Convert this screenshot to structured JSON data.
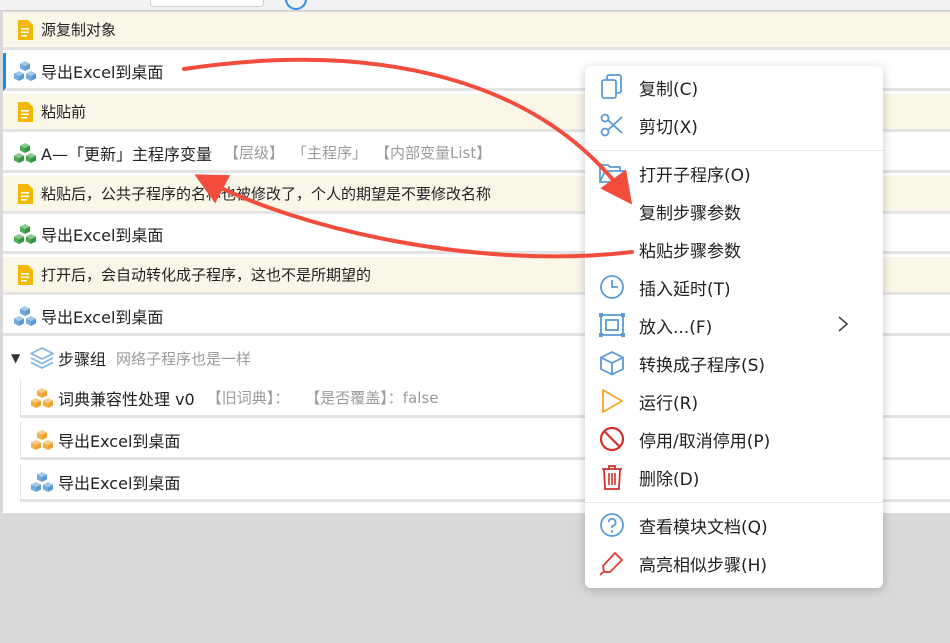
{
  "rows": {
    "r1": {
      "text": "源复制对象"
    },
    "r2": {
      "text": "导出Excel到桌面"
    },
    "r3": {
      "text": "粘贴前"
    },
    "r4": {
      "text": "A—「更新」主程序变量",
      "params": [
        "【层级】",
        "「主程序」",
        "【内部变量List】"
      ]
    },
    "r5": {
      "text": "粘贴后，公共子程序的名称也被修改了，个人的期望是不要修改名称"
    },
    "r6": {
      "text": "导出Excel到桌面"
    },
    "r7": {
      "text": "打开后，会自动转化成子程序，这也不是所期望的"
    },
    "r8": {
      "text": "导出Excel到桌面"
    },
    "group": {
      "text": "步骤组",
      "desc": "网络子程序也是一样"
    },
    "c1": {
      "text": "词典兼容性处理 v0",
      "params": [
        "【旧词典】：",
        "【是否覆盖】：false"
      ]
    },
    "c2": {
      "text": "导出Excel到桌面"
    },
    "c3": {
      "text": "导出Excel到桌面"
    }
  },
  "menu": {
    "copy": "复制(C)",
    "cut": "剪切(X)",
    "open_sub": "打开子程序(O)",
    "copy_params": "复制步骤参数",
    "paste_params": "粘贴步骤参数",
    "insert_delay": "插入延时(T)",
    "put_in": "放入...(F)",
    "convert_sub": "转换成子程序(S)",
    "run": "运行(R)",
    "disable": "停用/取消停用(P)",
    "delete": "删除(D)",
    "docs": "查看模块文档(Q)",
    "highlight": "高亮相似步骤(H)"
  },
  "colors": {
    "accent": "#1e88e5",
    "annotation_red": "#f24c3d",
    "note_bg": "#faf6e8",
    "note_icon": "#f5b800",
    "cube_green": "#2e9a3a",
    "cube_blue": "#5b9bd5",
    "cube_orange": "#f0a028"
  }
}
